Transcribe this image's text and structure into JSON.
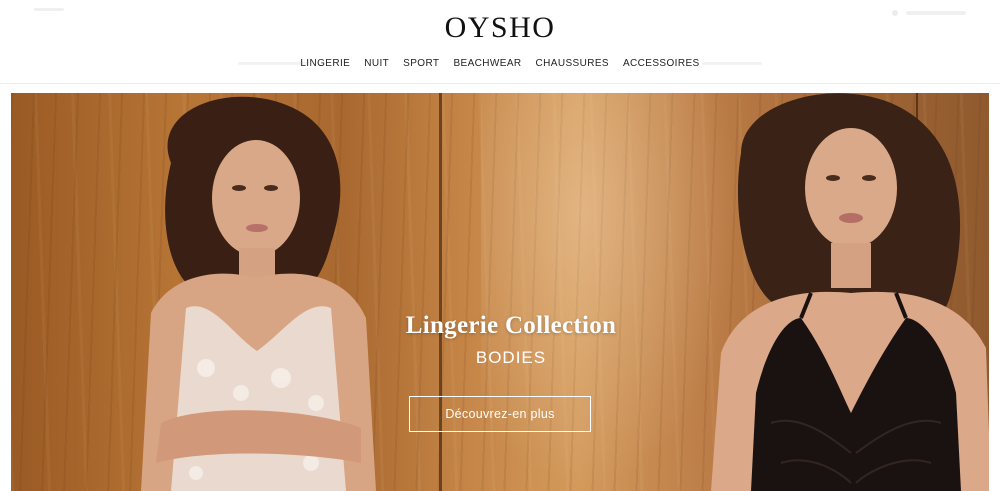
{
  "header": {
    "logo": "OYSHO",
    "nav": [
      {
        "label": "LINGERIE"
      },
      {
        "label": "NUIT"
      },
      {
        "label": "SPORT"
      },
      {
        "label": "BEACHWEAR"
      },
      {
        "label": "CHAUSSURES"
      },
      {
        "label": "ACCESSOIRES"
      }
    ]
  },
  "hero": {
    "title": "Lingerie Collection",
    "subtitle": "BODIES",
    "cta_label": "Découvrez-en plus",
    "image_left": "model-in-white-lace-bodysuit",
    "image_right": "model-in-black-lace-bra"
  },
  "colors": {
    "text_dark": "#111111",
    "hero_text": "#ffffff",
    "wood_brown": "#b87636"
  }
}
